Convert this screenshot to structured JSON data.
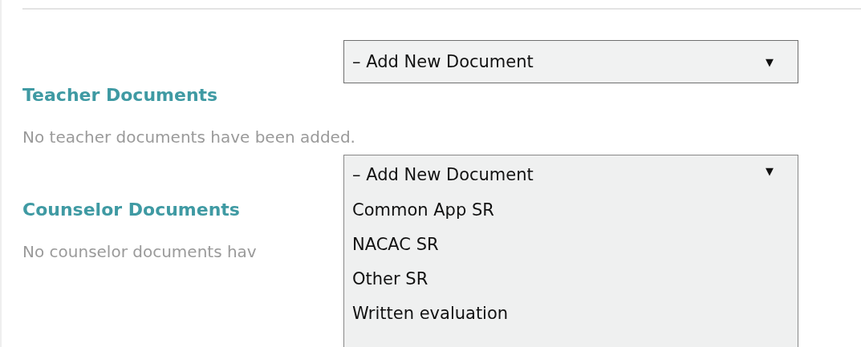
{
  "sections": [
    {
      "title": "Teacher Documents",
      "empty_text": "No teacher documents have been added.",
      "select": {
        "value": "– Add New Document",
        "arrow": "▼",
        "expanded": false
      }
    },
    {
      "title": "Counselor Documents",
      "empty_text": "No counselor documents hav",
      "select": {
        "value": "– Add New Document",
        "arrow": "▼",
        "expanded": true,
        "options": [
          {
            "label": "Common App SR",
            "selected": false
          },
          {
            "label": "NACAC SR",
            "selected": false
          },
          {
            "label": "Other SR",
            "selected": false
          },
          {
            "label": "Written evaluation",
            "selected": false
          }
        ]
      }
    }
  ]
}
